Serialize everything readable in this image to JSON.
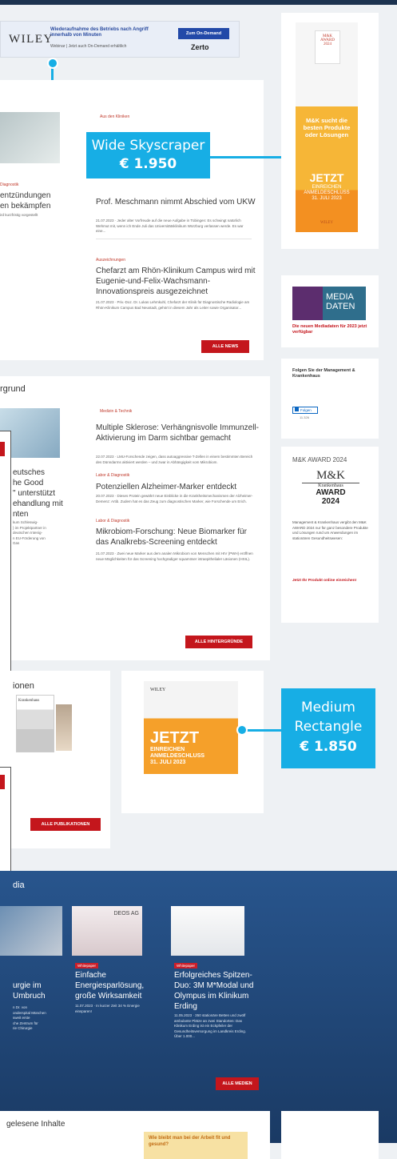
{
  "wiley_ad": {
    "logo": "WILEY",
    "text": "Wiederaufnahme des Betriebs nach Angriff innerhalb von Minuten",
    "sub": "Webinar | Jetzt auch On-Demand erhältlich",
    "button": "Zum On-Demand",
    "brand": "Zerto"
  },
  "callouts": {
    "left_top": "rd",
    "sky_title": "Wide Skyscraper",
    "sky_price": "€ 1.950",
    "medrect_line1": "Medium",
    "medrect_line2": "Rectangle",
    "medrect_price": "€ 1.850"
  },
  "news": {
    "left_headline": "entzündungen\nen bekämpfen",
    "left_label": "Diagnostik",
    "items": [
      {
        "label": "Aus den Kliniken",
        "title": "Prof. Meschmann nimmt Abschied vom UKW",
        "meta": "21.07.2023 · Jeder alter Vorfreude auf die neue Aufgabe in Tübingen: Es schwingt natürlich Wehmut mit, wenn ich Ende Juli das Universitätsklinikum Würzburg verlassen werde. Es war eine..."
      },
      {
        "label": "Auszeichnungen",
        "title": "Chefarzt am Rhön-Klinikum Campus wird mit Eugenie-und-Felix-Wachsmann-Innovationspreis ausgezeichnet",
        "meta": "21.07.2023 · Priv.-Doz. Dr. Lukas Lehmkuhl, Chefarzt der Klinik für Diagnostische Radiologie am Rhön-Klinikum Campus Bad Neustadt, gehört in diesem Jahr als Leiter sowie Organisator..."
      }
    ],
    "button": "ALLE NEWS"
  },
  "background": {
    "heading": "rgrund",
    "left_text": "eutsches\nhe Good\n\" unterstützt\nehandlung mit\nnten",
    "items": [
      {
        "label": "Medizin & Technik",
        "title": "Multiple Sklerose: Verhängnisvolle Immunzell-Aktivierung im Darm sichtbar gemacht",
        "meta": "22.07.2023 · LMU-Forschende zeigen, dass autoaggressive T-Zellen in einem bestimmten Bereich des Dünndarms aktiviert werden – und zwar in Abhängigkeit vom Mikrobiom."
      },
      {
        "label": "Labor & Diagnostik",
        "title": "Potenziellen Alzheimer-Marker entdeckt",
        "meta": "20.07.2023 · Dieses Protein gewährt neue Einblicke in die Krankheitsmechanismen der Alzheimer-Demenz: Artib. Zudem hat es das Zeug zum diagnostischen Marker, wie Forschende um Erich."
      },
      {
        "label": "Labor & Diagnostik",
        "title": "Mikrobiom-Forschung: Neue Biomarker für das Analkrebs-Screening entdeckt",
        "meta": "21.07.2023 · Zwei neue Marker aus dem analen Mikrobiom von Menschen mit HIV (PWH) eröffnen neue Möglichkeiten für das Screening hochgradiger squamöser intraepithelialer Läsionen (HSIL)."
      }
    ],
    "button": "ALLE HINTERGRÜNDE"
  },
  "sidebar": {
    "media_title": "MEDIA\nDATEN",
    "media_link": "Die neuen Mediadaten für 2023 jetzt verfügbar",
    "follow_title": "Folgen Sie der Management & Krankenhaus",
    "follow_button": "Folgen",
    "follow_count": "11.326",
    "award_title": "M&K AWARD 2024",
    "award_logo_top": "M&K",
    "award_logo_mid": "Krankenhaus",
    "award_logo_bottom": "AWARD\n2024",
    "award_text": "Management & Krankenhaus vergibt den M&K AWARD 2024 nur für ganz besondere Produkte und Lösungen rund um Anwendungen im stationären Gesundheitswesen:",
    "award_link": "Jetzt Ihr Produkt online einreichen!"
  },
  "skyscraper_ad": {
    "badge": "M&K\nAWARD\n2024",
    "message": "M&K sucht die besten Produkte oder Lösungen",
    "cta": "JETZT",
    "cta_sub": "EINREICHEN\nANMELDESCHLUSS\n31. JULI 2023",
    "brand": "WILEY"
  },
  "publications": {
    "heading": "ionen",
    "magazine": "Krankenhaus",
    "button": "ALLE PUBLIKATIONEN"
  },
  "medrect_ad": {
    "brand": "WILEY",
    "cta": "JETZT",
    "cta_sub": "EINREICHEN\nANMELDESCHLUSS\n31. JULI 2023"
  },
  "media": {
    "heading": "dia",
    "cards": [
      {
        "label": "",
        "title": "urgie im\nUmbruch",
        "meta": "n Dr. von\nonderspital München\nsweit erste\nche Zentrum für\nrie Chirurgie"
      },
      {
        "label": "Whitepaper",
        "title": "Einfache Energiesparlösung, große Wirksamkeit",
        "meta": "11.07.2023 · In kurzer Zeit 34 % Energie einsparen!"
      },
      {
        "label": "Whitepaper",
        "title": "Erfolgreiches Spitzen-Duo: 3M M*Modal und Olympus im Klinikum Erding",
        "meta": "11.05.2023 · 350 stationäre Betten und zwölf ambulante Plätze an zwei Standorten: Das Klinikum Erding ist ein Eckpfeiler der Gesundheitsversorgung im Landkreis Erding. Über 1.000..."
      }
    ],
    "button": "ALLE MEDIEN"
  },
  "most_read": {
    "heading": "gelesene Inhalte",
    "ad_text": "Wie bleibt man bei der Arbeit fit und gesund?"
  }
}
